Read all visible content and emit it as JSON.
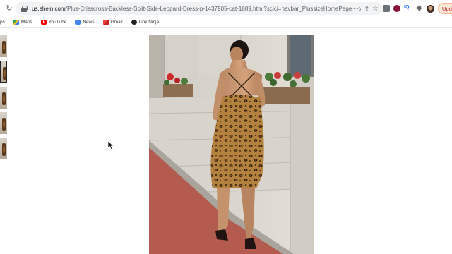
{
  "browser": {
    "url_host": "us.shein.com",
    "url_path": "/Plus-Crisscross-Backless-Split-Side-Leopard-Dress-p-1437905-cat-1889.html?scici=navbar_PlussizeHomePage~~tab02navbar04~~...",
    "update_label": "Upd",
    "bookmarks": [
      {
        "label": "Maps",
        "icon": "maps-icon"
      },
      {
        "label": "YouTube",
        "icon": "youtube-icon"
      },
      {
        "label": "News",
        "icon": "news-icon"
      },
      {
        "label": "Gmail",
        "icon": "gmail-icon"
      },
      {
        "label": "Link Ninja",
        "icon": "link-ninja-icon"
      }
    ],
    "bookmark_first_label": "ps"
  },
  "product": {
    "main_image": "leopard-print-slip-dress-photo",
    "thumbnail_count": 5,
    "selected_thumbnail": 2
  },
  "colors": {
    "accent_update": "#c5221f",
    "leopard_base": "#b5813f",
    "sidewalk": "#b25b4e"
  }
}
